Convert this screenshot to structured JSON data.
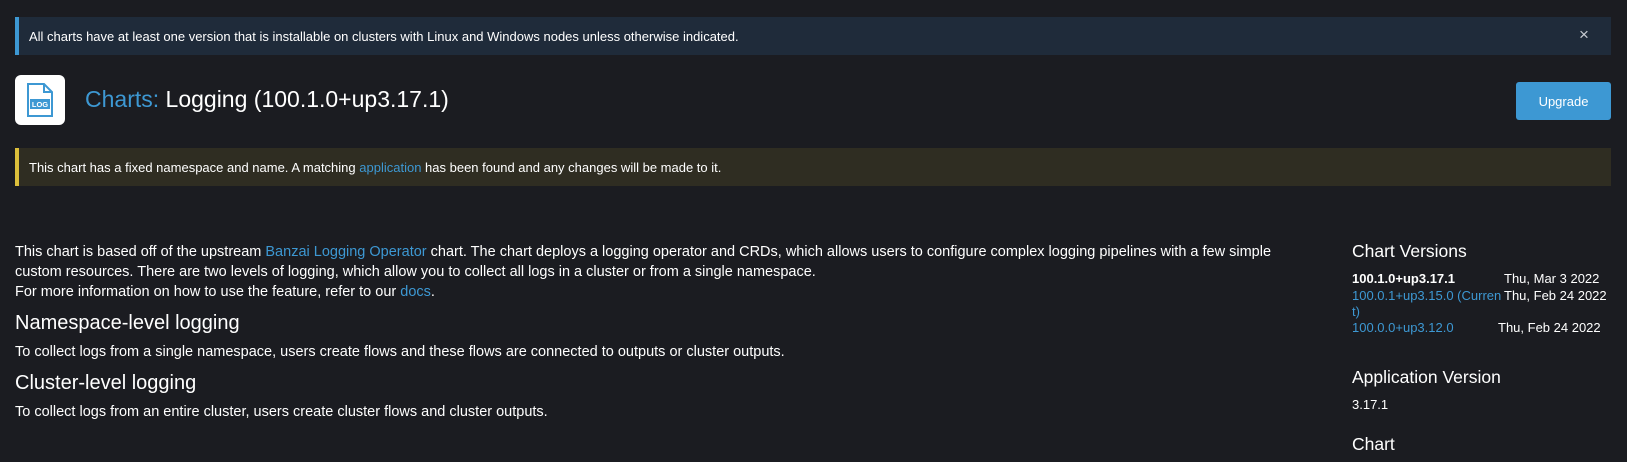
{
  "banner_info": {
    "text": "All charts have at least one version that is installable on clusters with Linux and Windows nodes unless otherwise indicated.",
    "close_icon": "×"
  },
  "header": {
    "logo_text": "LOG",
    "breadcrumb_link": "Charts:",
    "title": "Logging (100.1.0+up3.17.1)",
    "upgrade_label": "Upgrade"
  },
  "banner_warn": {
    "text_before": "This chart has a fixed namespace and name. A matching ",
    "link": "application",
    "text_after": " has been found and any changes will be made to it."
  },
  "readme": {
    "intro_before": "This chart is based off of the upstream ",
    "intro_link": "Banzai Logging Operator",
    "intro_after": " chart. The chart deploys a logging operator and CRDs, which allows users to configure complex logging pipelines with a few simple custom resources. There are two levels of logging, which allow you to collect all logs in a cluster or from a single namespace.",
    "more_before": "For more information on how to use the feature, refer to our ",
    "more_link": "docs",
    "more_after": ".",
    "sections": [
      {
        "heading": "Namespace-level logging",
        "body": "To collect logs from a single namespace, users create flows and these flows are connected to outputs or cluster outputs."
      },
      {
        "heading": "Cluster-level logging",
        "body": "To collect logs from an entire cluster, users create cluster flows and cluster outputs."
      }
    ]
  },
  "sidebar": {
    "versions_heading": "Chart Versions",
    "versions": [
      {
        "name": "100.1.0+up3.17.1",
        "date": "Thu, Mar 3 2022",
        "current": true
      },
      {
        "name": "100.0.1+up3.15.0 (Current)",
        "date": "Thu, Feb 24 2022",
        "current": false
      },
      {
        "name": "100.0.0+up3.12.0",
        "date": "Thu, Feb 24 2022",
        "current": false
      }
    ],
    "app_version_heading": "Application Version",
    "app_version": "3.17.1",
    "chart_heading": "Chart"
  },
  "colors": {
    "background": "#1b1c21",
    "accent": "#3d98d3",
    "info_border": "#3d98d3",
    "warn_border": "#dcbf3b"
  }
}
